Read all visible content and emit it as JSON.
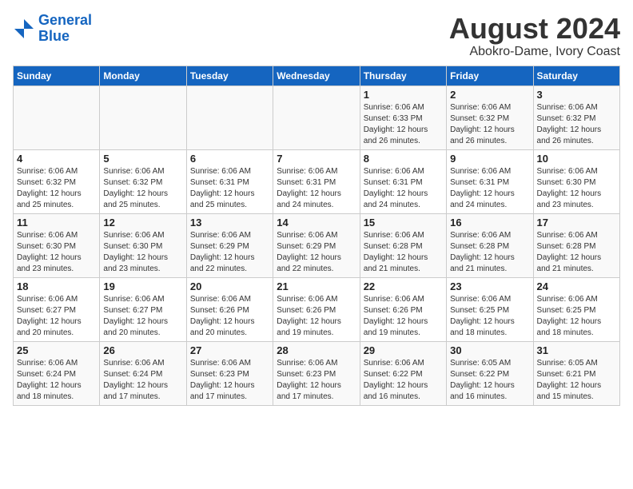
{
  "header": {
    "logo_line1": "General",
    "logo_line2": "Blue",
    "title": "August 2024",
    "subtitle": "Abokro-Dame, Ivory Coast"
  },
  "days_of_week": [
    "Sunday",
    "Monday",
    "Tuesday",
    "Wednesday",
    "Thursday",
    "Friday",
    "Saturday"
  ],
  "weeks": [
    [
      {
        "day": "",
        "info": ""
      },
      {
        "day": "",
        "info": ""
      },
      {
        "day": "",
        "info": ""
      },
      {
        "day": "",
        "info": ""
      },
      {
        "day": "1",
        "info": "Sunrise: 6:06 AM\nSunset: 6:33 PM\nDaylight: 12 hours\nand 26 minutes."
      },
      {
        "day": "2",
        "info": "Sunrise: 6:06 AM\nSunset: 6:32 PM\nDaylight: 12 hours\nand 26 minutes."
      },
      {
        "day": "3",
        "info": "Sunrise: 6:06 AM\nSunset: 6:32 PM\nDaylight: 12 hours\nand 26 minutes."
      }
    ],
    [
      {
        "day": "4",
        "info": "Sunrise: 6:06 AM\nSunset: 6:32 PM\nDaylight: 12 hours\nand 25 minutes."
      },
      {
        "day": "5",
        "info": "Sunrise: 6:06 AM\nSunset: 6:32 PM\nDaylight: 12 hours\nand 25 minutes."
      },
      {
        "day": "6",
        "info": "Sunrise: 6:06 AM\nSunset: 6:31 PM\nDaylight: 12 hours\nand 25 minutes."
      },
      {
        "day": "7",
        "info": "Sunrise: 6:06 AM\nSunset: 6:31 PM\nDaylight: 12 hours\nand 24 minutes."
      },
      {
        "day": "8",
        "info": "Sunrise: 6:06 AM\nSunset: 6:31 PM\nDaylight: 12 hours\nand 24 minutes."
      },
      {
        "day": "9",
        "info": "Sunrise: 6:06 AM\nSunset: 6:31 PM\nDaylight: 12 hours\nand 24 minutes."
      },
      {
        "day": "10",
        "info": "Sunrise: 6:06 AM\nSunset: 6:30 PM\nDaylight: 12 hours\nand 23 minutes."
      }
    ],
    [
      {
        "day": "11",
        "info": "Sunrise: 6:06 AM\nSunset: 6:30 PM\nDaylight: 12 hours\nand 23 minutes."
      },
      {
        "day": "12",
        "info": "Sunrise: 6:06 AM\nSunset: 6:30 PM\nDaylight: 12 hours\nand 23 minutes."
      },
      {
        "day": "13",
        "info": "Sunrise: 6:06 AM\nSunset: 6:29 PM\nDaylight: 12 hours\nand 22 minutes."
      },
      {
        "day": "14",
        "info": "Sunrise: 6:06 AM\nSunset: 6:29 PM\nDaylight: 12 hours\nand 22 minutes."
      },
      {
        "day": "15",
        "info": "Sunrise: 6:06 AM\nSunset: 6:28 PM\nDaylight: 12 hours\nand 21 minutes."
      },
      {
        "day": "16",
        "info": "Sunrise: 6:06 AM\nSunset: 6:28 PM\nDaylight: 12 hours\nand 21 minutes."
      },
      {
        "day": "17",
        "info": "Sunrise: 6:06 AM\nSunset: 6:28 PM\nDaylight: 12 hours\nand 21 minutes."
      }
    ],
    [
      {
        "day": "18",
        "info": "Sunrise: 6:06 AM\nSunset: 6:27 PM\nDaylight: 12 hours\nand 20 minutes."
      },
      {
        "day": "19",
        "info": "Sunrise: 6:06 AM\nSunset: 6:27 PM\nDaylight: 12 hours\nand 20 minutes."
      },
      {
        "day": "20",
        "info": "Sunrise: 6:06 AM\nSunset: 6:26 PM\nDaylight: 12 hours\nand 20 minutes."
      },
      {
        "day": "21",
        "info": "Sunrise: 6:06 AM\nSunset: 6:26 PM\nDaylight: 12 hours\nand 19 minutes."
      },
      {
        "day": "22",
        "info": "Sunrise: 6:06 AM\nSunset: 6:26 PM\nDaylight: 12 hours\nand 19 minutes."
      },
      {
        "day": "23",
        "info": "Sunrise: 6:06 AM\nSunset: 6:25 PM\nDaylight: 12 hours\nand 18 minutes."
      },
      {
        "day": "24",
        "info": "Sunrise: 6:06 AM\nSunset: 6:25 PM\nDaylight: 12 hours\nand 18 minutes."
      }
    ],
    [
      {
        "day": "25",
        "info": "Sunrise: 6:06 AM\nSunset: 6:24 PM\nDaylight: 12 hours\nand 18 minutes."
      },
      {
        "day": "26",
        "info": "Sunrise: 6:06 AM\nSunset: 6:24 PM\nDaylight: 12 hours\nand 17 minutes."
      },
      {
        "day": "27",
        "info": "Sunrise: 6:06 AM\nSunset: 6:23 PM\nDaylight: 12 hours\nand 17 minutes."
      },
      {
        "day": "28",
        "info": "Sunrise: 6:06 AM\nSunset: 6:23 PM\nDaylight: 12 hours\nand 17 minutes."
      },
      {
        "day": "29",
        "info": "Sunrise: 6:06 AM\nSunset: 6:22 PM\nDaylight: 12 hours\nand 16 minutes."
      },
      {
        "day": "30",
        "info": "Sunrise: 6:05 AM\nSunset: 6:22 PM\nDaylight: 12 hours\nand 16 minutes."
      },
      {
        "day": "31",
        "info": "Sunrise: 6:05 AM\nSunset: 6:21 PM\nDaylight: 12 hours\nand 15 minutes."
      }
    ]
  ]
}
